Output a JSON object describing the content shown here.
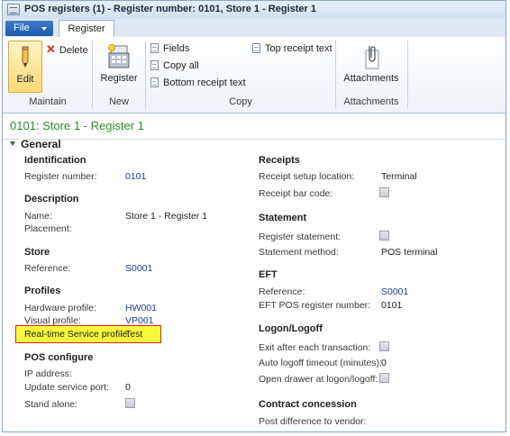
{
  "window": {
    "title": "POS registers (1) - Register number: 0101, Store 1 - Register 1"
  },
  "ribbon": {
    "file_label": "File",
    "tab_label": "Register",
    "maintain": {
      "edit": "Edit",
      "delete": "Delete",
      "group": "Maintain"
    },
    "new": {
      "register": "Register",
      "group": "New"
    },
    "copy": {
      "fields": "Fields",
      "copy_all": "Copy all",
      "bottom_receipt_text": "Bottom receipt text",
      "top_receipt_text": "Top receipt text",
      "group": "Copy"
    },
    "attachments": {
      "label": "Attachments",
      "group": "Attachments"
    }
  },
  "record": {
    "title": "0101: Store 1 - Register 1"
  },
  "section": {
    "title": "General"
  },
  "left": {
    "identification": {
      "heading": "Identification",
      "register_number_label": "Register number:",
      "register_number_value": "0101"
    },
    "description": {
      "heading": "Description",
      "name_label": "Name:",
      "name_value": "Store 1 - Register 1",
      "placement_label": "Placement:"
    },
    "store": {
      "heading": "Store",
      "reference_label": "Reference:",
      "reference_value": "S0001"
    },
    "profiles": {
      "heading": "Profiles",
      "hardware_label": "Hardware profile:",
      "hardware_value": "HW001",
      "visual_label": "Visual profile:",
      "visual_value": "VP001",
      "realtime_label": "Real-time Service profile:",
      "realtime_value": "Test"
    },
    "pos_configure": {
      "heading": "POS configure",
      "ip_label": "IP address:",
      "port_label": "Update service port:",
      "port_value": "0",
      "standalone_label": "Stand alone:"
    }
  },
  "right": {
    "receipts": {
      "heading": "Receipts",
      "setup_label": "Receipt setup location:",
      "setup_value": "Terminal",
      "barcode_label": "Receipt bar code:"
    },
    "statement": {
      "heading": "Statement",
      "register_label": "Register statement:",
      "method_label": "Statement method:",
      "method_value": "POS terminal"
    },
    "eft": {
      "heading": "EFT",
      "reference_label": "Reference:",
      "reference_value": "S0001",
      "pos_number_label": "EFT POS register number:",
      "pos_number_value": "0101"
    },
    "logon": {
      "heading": "Logon/Logoff",
      "exit_label": "Exit after each transaction:",
      "auto_label": "Auto logoff timeout (minutes):",
      "auto_value": "0",
      "drawer_label": "Open drawer at logon/logoff:"
    },
    "contract": {
      "heading": "Contract concession",
      "post_label": "Post difference to vendor:"
    }
  }
}
